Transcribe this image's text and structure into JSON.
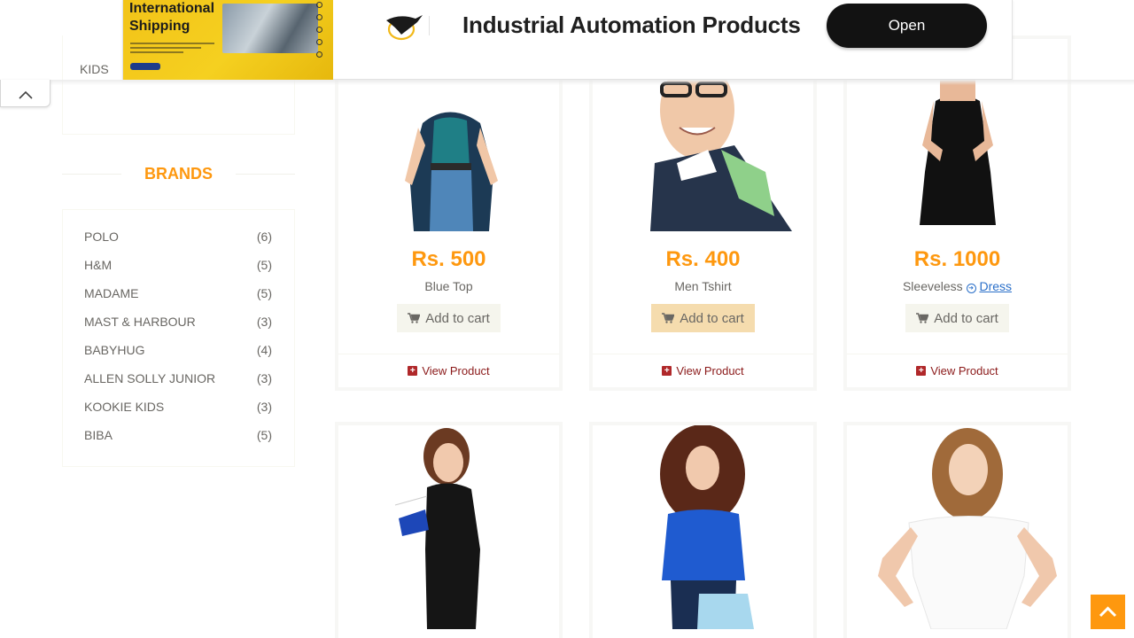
{
  "sidebar": {
    "category_kids": "KIDS",
    "brands_title": "BRANDS",
    "brands": [
      {
        "name": "POLO",
        "count": "(6)"
      },
      {
        "name": "H&M",
        "count": "(5)"
      },
      {
        "name": "MADAME",
        "count": "(5)"
      },
      {
        "name": "MAST & HARBOUR",
        "count": "(3)"
      },
      {
        "name": "BABYHUG",
        "count": "(4)"
      },
      {
        "name": "ALLEN SOLLY JUNIOR",
        "count": "(3)"
      },
      {
        "name": "KOOKIE KIDS",
        "count": "(3)"
      },
      {
        "name": "BIBA",
        "count": "(5)"
      }
    ]
  },
  "products": [
    {
      "price": "Rs. 500",
      "name": "Blue Top",
      "category": "",
      "cart_label": "Add to cart",
      "view_label": "View Product"
    },
    {
      "price": "Rs. 400",
      "name": "Men Tshirt",
      "category": "",
      "cart_label": "Add to cart",
      "view_label": "View Product"
    },
    {
      "price": "Rs. 1000",
      "name": "Sleeveless",
      "category": "Dress",
      "cart_label": "Add to cart",
      "view_label": "View Product"
    }
  ],
  "ad": {
    "image_headline_1": "International",
    "image_headline_2": "Shipping",
    "title": "Industrial Automation Products",
    "button": "Open"
  },
  "colors": {
    "accent": "#FE980F",
    "cart_hover": "#f5dcae",
    "view_product": "#8b1a1a",
    "ad_button": "#121212"
  }
}
